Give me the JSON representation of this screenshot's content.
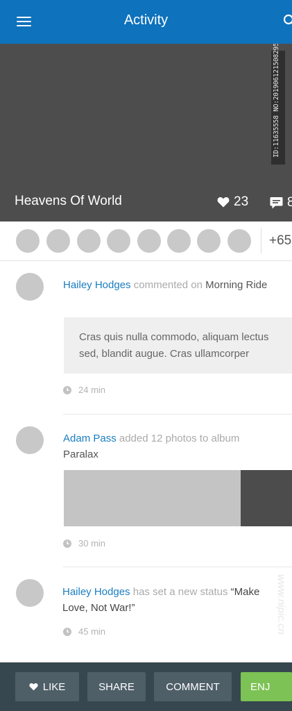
{
  "header": {
    "title": "Activity"
  },
  "hero": {
    "title": "Heavens Of World",
    "likes": "23",
    "comments": "8",
    "watermark": "ID:11635558 NO:20190612150829589000"
  },
  "participants": {
    "more_label": "+65"
  },
  "feed": [
    {
      "user": "Hailey Hodges",
      "action": "commented on",
      "target": "Morning Ride",
      "quote": "Cras quis nulla commodo, aliquam lectus sed, blandit augue. Cras ullamcorper",
      "time": "24 min"
    },
    {
      "user": "Adam Pass",
      "action": "added 12 photos to album",
      "target": "Paralax",
      "time": "30 min"
    },
    {
      "user": "Hailey Hodges",
      "action": "has set a new status",
      "target": "“Make Love, Not War!”",
      "time": "45 min"
    }
  ],
  "actions": {
    "like": "LIKE",
    "share": "SHARE",
    "comment": "COMMENT",
    "enjoy": "ENJ"
  },
  "site_watermark": "www.nipic.cn",
  "colors": {
    "primary": "#0e72bc",
    "link": "#1a7dc0",
    "hero_bg": "#4d4d4d",
    "bottom_bar": "#37474f",
    "button": "#4e5f68",
    "enjoy_button": "#7cc255"
  }
}
